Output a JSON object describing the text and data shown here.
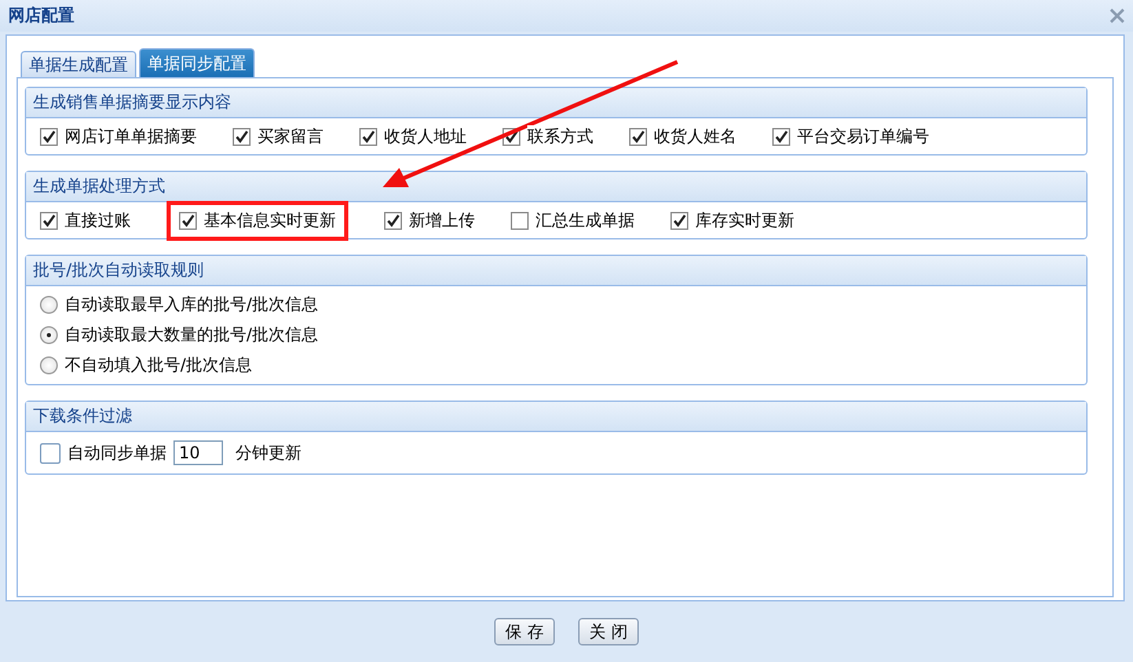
{
  "window": {
    "title": "网店配置"
  },
  "tabs": [
    {
      "label": "单据生成配置",
      "selected": false
    },
    {
      "label": "单据同步配置",
      "selected": true
    }
  ],
  "sections": [
    {
      "title": "生成销售单据摘要显示内容",
      "kind": "checks",
      "items": [
        {
          "label": "网店订单单据摘要",
          "checked": true,
          "highlighted": false
        },
        {
          "label": "买家留言",
          "checked": true,
          "highlighted": false
        },
        {
          "label": "收货人地址",
          "checked": true,
          "highlighted": false
        },
        {
          "label": "联系方式",
          "checked": true,
          "highlighted": false
        },
        {
          "label": "收货人姓名",
          "checked": true,
          "highlighted": false
        },
        {
          "label": "平台交易订单编号",
          "checked": true,
          "highlighted": false
        }
      ]
    },
    {
      "title": "生成单据处理方式",
      "kind": "checks",
      "items": [
        {
          "label": "直接过账",
          "checked": true,
          "highlighted": false
        },
        {
          "label": "基本信息实时更新",
          "checked": true,
          "highlighted": true
        },
        {
          "label": "新增上传",
          "checked": true,
          "highlighted": false
        },
        {
          "label": "汇总生成单据",
          "checked": false,
          "highlighted": false
        },
        {
          "label": "库存实时更新",
          "checked": true,
          "highlighted": false
        }
      ]
    },
    {
      "title": "批号/批次自动读取规则",
      "kind": "radios",
      "items": [
        {
          "label": "自动读取最早入库的批号/批次信息",
          "selected": false
        },
        {
          "label": "自动读取最大数量的批号/批次信息",
          "selected": true
        },
        {
          "label": "不自动填入批号/批次信息",
          "selected": false
        }
      ]
    },
    {
      "title": "下载条件过滤",
      "kind": "sync",
      "checkbox": {
        "label": "自动同步单据",
        "checked": false
      },
      "field": {
        "value": "10"
      },
      "suffix": "分钟更新"
    }
  ],
  "buttons": [
    "保 存",
    "关 闭"
  ]
}
